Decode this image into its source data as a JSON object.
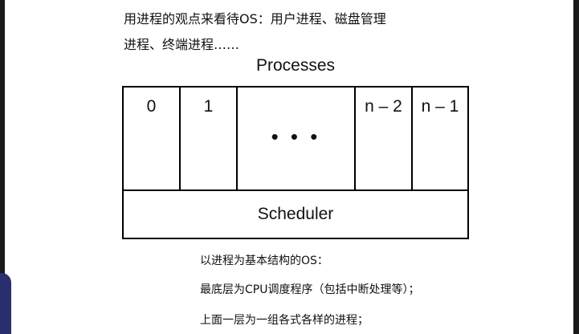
{
  "heading": {
    "line1": "用进程的观点来看待OS：用户进程、磁盘管理",
    "line2": "进程、终端进程……"
  },
  "diagram": {
    "title": "Processes",
    "cells": [
      "0",
      "1",
      "• • •",
      "n – 2",
      "n – 1"
    ],
    "scheduler_label": "Scheduler"
  },
  "notes": [
    "以进程为基本结构的OS：",
    "最底层为CPU调度程序（包括中断处理等）；",
    "上面一层为一组各式各样的进程；"
  ],
  "colors": {
    "background": "#1a1a1a",
    "slide": "#ffffff",
    "presenter": "#2a2f6e"
  }
}
